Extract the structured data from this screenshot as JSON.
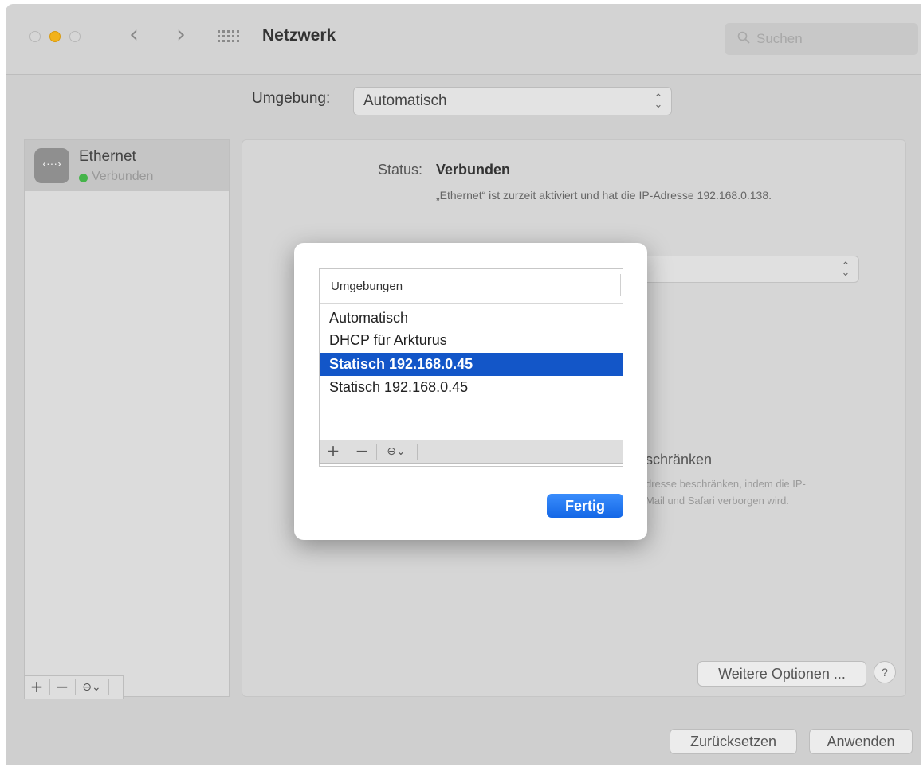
{
  "window": {
    "title": "Netzwerk",
    "search_placeholder": "Suchen"
  },
  "environment": {
    "label": "Umgebung:",
    "value": "Automatisch"
  },
  "sidebar": {
    "items": [
      {
        "name": "Ethernet",
        "status": "Verbunden",
        "icon": "ethernet-icon",
        "icon_glyph": "‹···›"
      }
    ]
  },
  "toolbar": {
    "add": "+",
    "remove": "−",
    "action": "⊖⌄"
  },
  "detail": {
    "status_label": "Status:",
    "status_value": "Verbunden",
    "status_description": "„Ethernet“ ist zurzeit aktiviert und hat die IP-Adresse 192.168.0.138.",
    "restrict_title": "schränken",
    "restrict_desc_line1": "dresse beschränken, indem die IP-",
    "restrict_desc_line2": "Mail und Safari verborgen wird.",
    "more_options": "Weitere Optionen ...",
    "help": "?"
  },
  "footer": {
    "reset": "Zurücksetzen",
    "apply": "Anwenden"
  },
  "dialog": {
    "header": "Umgebungen",
    "items": [
      {
        "label": "Automatisch",
        "selected": false
      },
      {
        "label": "DHCP für Arkturus",
        "selected": false
      },
      {
        "label": "Statisch 192.168.0.45",
        "selected": true
      },
      {
        "label": "Statisch 192.168.0.45",
        "selected": false
      }
    ],
    "done": "Fertig"
  },
  "colors": {
    "selection": "#1356c8",
    "accent": "#1467e6",
    "status_green": "#45b44a",
    "minimize": "#f2b21b"
  }
}
